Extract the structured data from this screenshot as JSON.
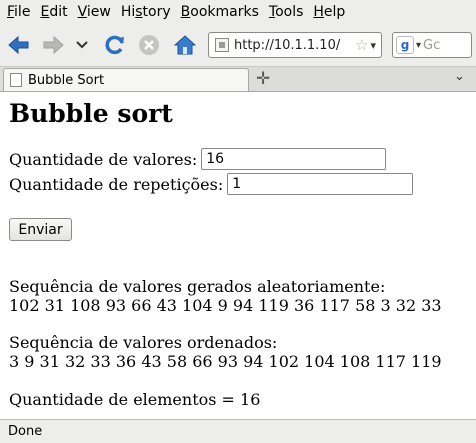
{
  "menubar": {
    "items": [
      {
        "label_first": "F",
        "label_rest": "ile"
      },
      {
        "label_first": "E",
        "label_rest": "dit"
      },
      {
        "label_first": "V",
        "label_rest": "iew"
      },
      {
        "label_first": "",
        "label_rest": "History"
      },
      {
        "label_first": "B",
        "label_rest": "ookmarks"
      },
      {
        "label_first": "T",
        "label_rest": "ools"
      },
      {
        "label_first": "H",
        "label_rest": "elp"
      }
    ]
  },
  "navbar": {
    "url": "http://10.1.1.10/",
    "search_placeholder": "Gc",
    "icons": [
      "back-arrow-icon",
      "forward-arrow-icon",
      "history-dropdown-icon",
      "reload-icon",
      "stop-icon",
      "home-icon",
      "star-icon",
      "google-icon"
    ],
    "colors": {
      "back": "#2d6fc0",
      "reload": "#2d6fc0",
      "stop": "#b8b8b4",
      "home": "#3a7bd0"
    }
  },
  "tabs": {
    "active_title": "Bubble Sort"
  },
  "page": {
    "heading": "Bubble sort",
    "quantity_label": "Quantidade de valores:",
    "quantity_value": "16",
    "repetitions_label": "Quantidade de repetições:",
    "repetitions_value": "1",
    "submit_label": "Enviar",
    "random_heading": "Sequência de valores gerados aleatoriamente:",
    "random_values": "102 31 108 93 66 43 104 9 94 119 36 117 58 3 32 33",
    "sorted_heading": "Sequência de valores ordenados:",
    "sorted_values": "3 9 31 32 33 36 43 58 66 93 94 102 104 108 117 119",
    "count_text": "Quantidade de elementos = 16"
  },
  "statusbar": {
    "text": "Done"
  }
}
